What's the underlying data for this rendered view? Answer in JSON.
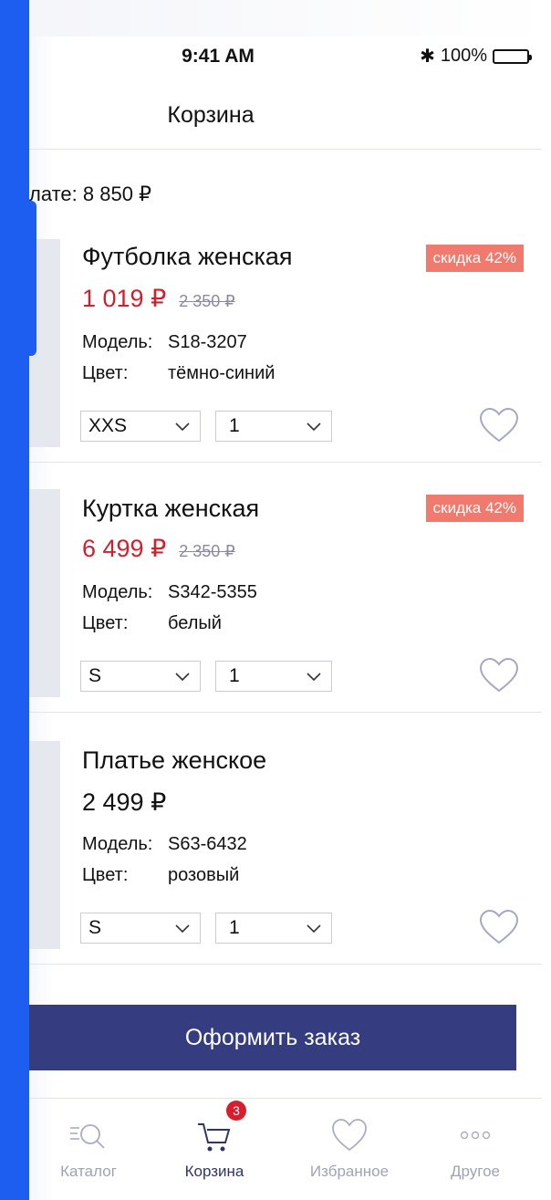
{
  "status_bar": {
    "time": "9:41 AM",
    "battery": "100%"
  },
  "nav": {
    "title": "Корзина"
  },
  "summary": {
    "text": "лате: 8 850 ₽"
  },
  "products": [
    {
      "name": "Футболка женская",
      "badge": "скидка 42%",
      "price": "1 019 ₽",
      "old_price": "2 350 ₽",
      "model_label": "Модель:",
      "model": "S18-3207",
      "color_label": "Цвет:",
      "color": "тёмно-синий",
      "size": "XXS",
      "qty": "1"
    },
    {
      "name": "Куртка женская",
      "badge": "скидка 42%",
      "price": "6 499 ₽",
      "old_price": "2 350 ₽",
      "model_label": "Модель:",
      "model": "S342-5355",
      "color_label": "Цвет:",
      "color": "белый",
      "size": "S",
      "qty": "1"
    },
    {
      "name": "Платье женское",
      "price": "2 499 ₽",
      "model_label": "Модель:",
      "model": "S63-6432",
      "color_label": "Цвет:",
      "color": "розовый",
      "size": "S",
      "qty": "1"
    }
  ],
  "checkout_button": "Оформить заказ",
  "tabbar": {
    "catalog": "Каталог",
    "cart": "Корзина",
    "cart_count": "3",
    "favorites": "Избранное",
    "other": "Другое"
  },
  "colors": {
    "accent": "#353c7f",
    "sale": "#d0202e",
    "badge": "#f07a6e",
    "edge": "#1d5ef0"
  }
}
